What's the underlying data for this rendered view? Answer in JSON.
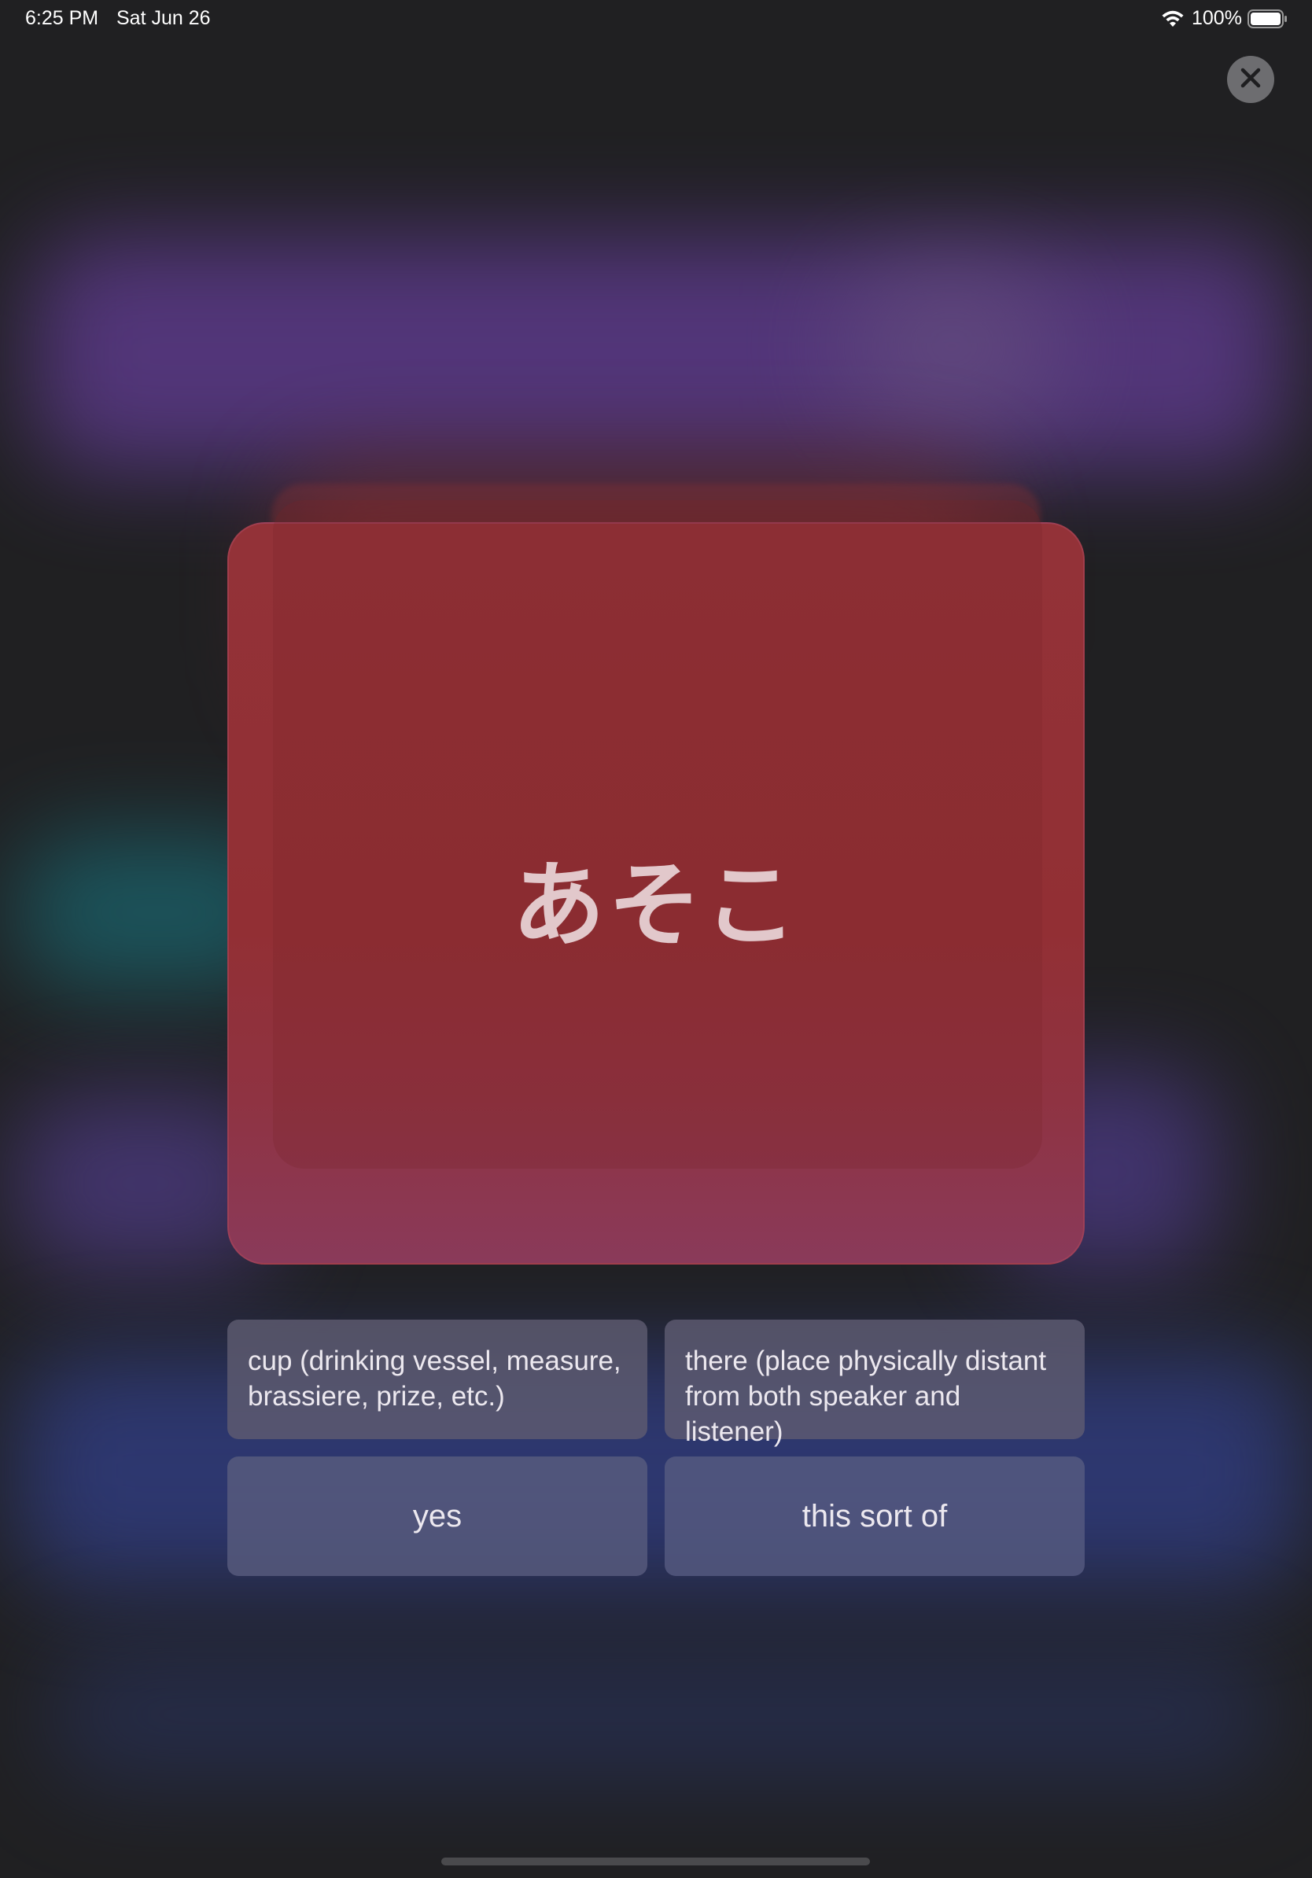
{
  "status_bar": {
    "time": "6:25 PM",
    "date": "Sat Jun 26",
    "battery": "100%",
    "wifi_icon": "wifi-icon",
    "battery_icon": "battery-full-icon"
  },
  "close_button": {
    "icon": "close-icon"
  },
  "card": {
    "word": "あそこ",
    "color": "#933238"
  },
  "options": [
    {
      "label": "cup (drinking vessel, measure, brassiere, prize, etc.)"
    },
    {
      "label": "there (place physically distant from both speaker and listener)"
    },
    {
      "label": "yes"
    },
    {
      "label": "this sort of"
    }
  ],
  "colors": {
    "background": "#202022",
    "option_bg": "#5e5c70",
    "option_text": "#ece8ef",
    "card_text": "#e2c8cb"
  }
}
